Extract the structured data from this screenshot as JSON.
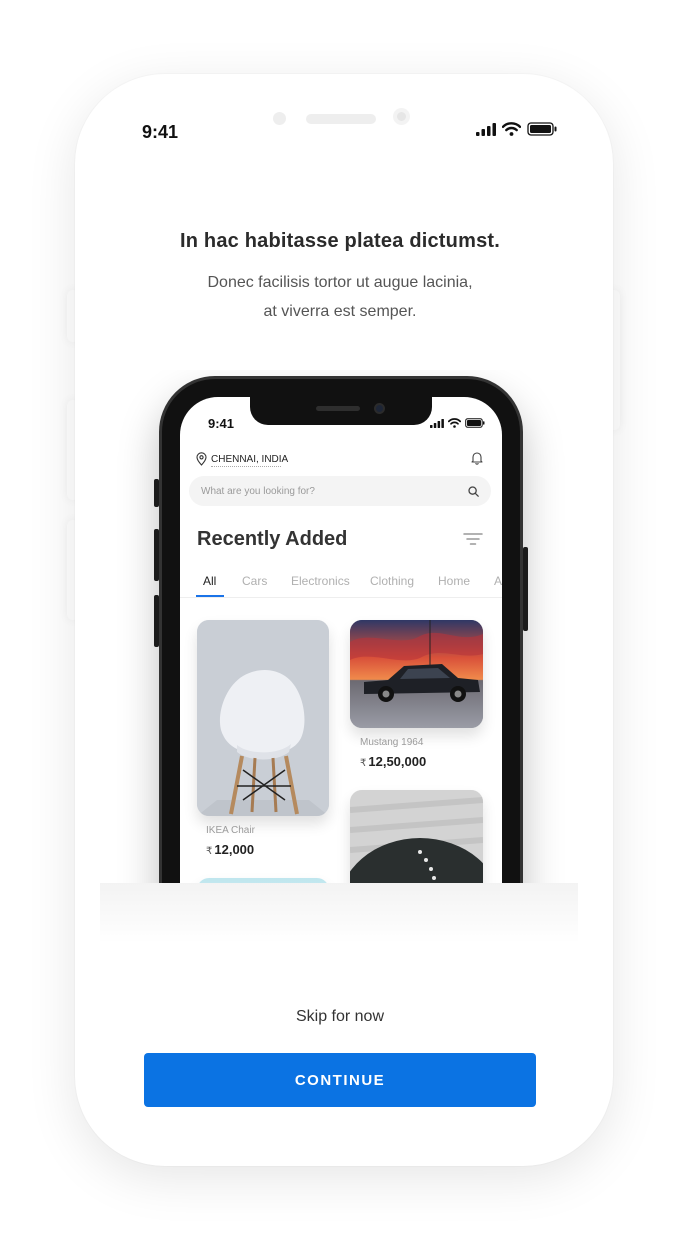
{
  "outer_status": {
    "time": "9:41"
  },
  "onboarding": {
    "headline": "In hac habitasse platea dictumst.",
    "subtext_line1": "Donec facilisis tortor ut augue lacinia,",
    "subtext_line2": "at viverra est semper."
  },
  "inner_app": {
    "status_time": "9:41",
    "location": "CHENNAI, INDIA",
    "search_placeholder": "What are you looking for?",
    "section_title": "Recently Added",
    "tabs": [
      "All",
      "Cars",
      "Electronics",
      "Clothing",
      "Home",
      "A"
    ],
    "active_tab": "All",
    "items": [
      {
        "name": "IKEA Chair",
        "currency": "₹",
        "price": "12,000"
      },
      {
        "name": "Mustang 1964",
        "currency": "₹",
        "price": "12,50,000"
      }
    ]
  },
  "actions": {
    "skip_label": "Skip for now",
    "continue_label": "CONTINUE"
  },
  "colors": {
    "primary": "#0b73e3",
    "tab_active_underline": "#1a73e8"
  }
}
